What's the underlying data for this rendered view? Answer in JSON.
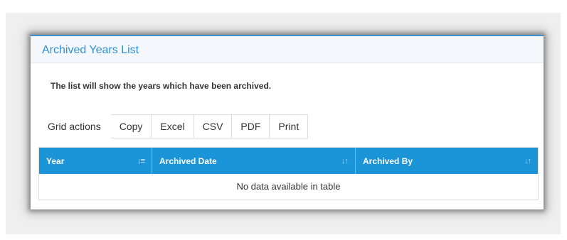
{
  "panel": {
    "title": "Archived Years List",
    "description": "The list will show the years which have been archived.",
    "accent_color": "#1c94d8"
  },
  "grid_actions": {
    "label": "Grid actions",
    "buttons": [
      "Copy",
      "Excel",
      "CSV",
      "PDF",
      "Print"
    ]
  },
  "table": {
    "columns": [
      {
        "label": "Year",
        "sort_icon": "sort-ascending-icon"
      },
      {
        "label": "Archived Date",
        "sort_icon": "sort-both-icon"
      },
      {
        "label": "Archived By",
        "sort_icon": "sort-both-icon"
      }
    ],
    "empty_message": "No data available in table"
  }
}
